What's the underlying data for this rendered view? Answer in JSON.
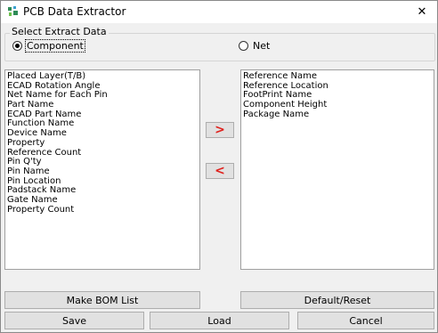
{
  "window": {
    "title": "PCB Data Extractor",
    "close_glyph": "✕"
  },
  "extract": {
    "legend": "Select Extract Data",
    "options": [
      {
        "label": "Component",
        "selected": true
      },
      {
        "label": "Net",
        "selected": false
      }
    ]
  },
  "available_list": {
    "items": [
      "Placed Layer(T/B)",
      "ECAD Rotation Angle",
      "Net Name for Each Pin",
      "Part Name",
      "ECAD Part Name",
      "Function Name",
      "Device Name",
      "Property",
      "Reference Count",
      "Pin Q'ty",
      "Pin Name",
      "Pin Location",
      "Padstack Name",
      "Gate Name",
      "Property Count"
    ]
  },
  "selected_list": {
    "items": [
      "Reference Name",
      "Reference Location",
      "FootPrint Name",
      "Component Height",
      "Package Name"
    ]
  },
  "buttons": {
    "add_glyph": ">",
    "remove_glyph": "<",
    "make_bom": "Make BOM List",
    "default_reset": "Default/Reset",
    "save": "Save",
    "load": "Load",
    "cancel": "Cancel"
  },
  "colors": {
    "arrow": "#e0201c",
    "accent_icon": "#2e8b57"
  }
}
